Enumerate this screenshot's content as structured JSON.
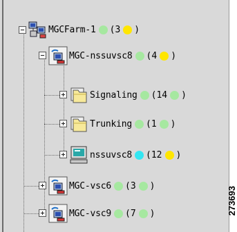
{
  "colors": {
    "status_green": "#a6e8a0",
    "status_yellow": "#ffe600",
    "status_cyan": "#33e6f2"
  },
  "tree": {
    "farm": {
      "label": "MGCFarm-1",
      "status": "status_green",
      "count_open": "(3",
      "count_status": "status_yellow",
      "count_close": ")",
      "icon": "farm-network-icon"
    },
    "host1": {
      "label": "MGC-nssuvsc8",
      "status": "status_green",
      "count_open": "(4",
      "count_status": "status_yellow",
      "count_close": ")",
      "icon": "mgc-host-icon"
    },
    "signaling": {
      "label": "Signaling",
      "status": "status_green",
      "count_open": "(14",
      "count_status": "status_green",
      "count_close": ")",
      "icon": "folder-icon"
    },
    "trunking": {
      "label": "Trunking",
      "status": "status_green",
      "count_open": "(1",
      "count_status": "status_green",
      "count_close": ")",
      "icon": "folder-icon"
    },
    "nssuvsc8": {
      "label": "nssuvsc8",
      "status": "status_cyan",
      "count_open": "(12",
      "count_status": "status_yellow",
      "count_close": ")",
      "icon": "computer-icon"
    },
    "host2": {
      "label": "MGC-vsc6",
      "status": "status_green",
      "count_open": "(3",
      "count_status": "status_green",
      "count_close": ")",
      "icon": "mgc-host-icon"
    },
    "host3": {
      "label": "MGC-vsc9",
      "status": "status_green",
      "count_open": "(7",
      "count_status": "status_green",
      "count_close": ")",
      "icon": "mgc-host-icon"
    }
  },
  "figure_id": "273693"
}
